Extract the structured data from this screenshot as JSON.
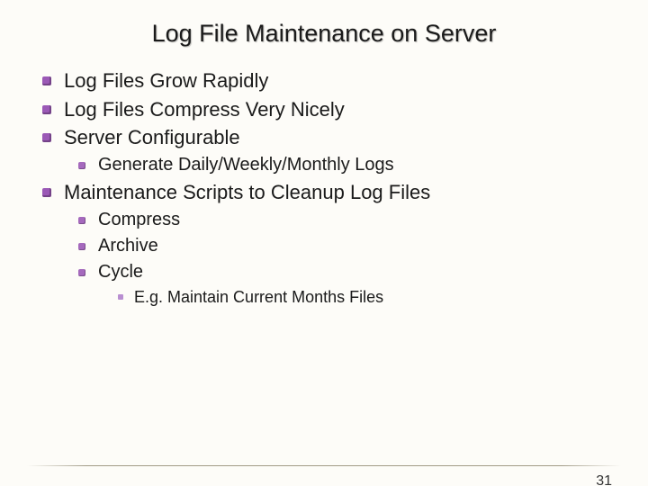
{
  "title": "Log File Maintenance on Server",
  "bullets": {
    "b1": "Log Files Grow Rapidly",
    "b2": "Log Files Compress Very Nicely",
    "b3": "Server Configurable",
    "b3_1": "Generate Daily/Weekly/Monthly Logs",
    "b4": "Maintenance Scripts to Cleanup Log Files",
    "b4_1": "Compress",
    "b4_2": "Archive",
    "b4_3": "Cycle",
    "b4_3_1": "E.g. Maintain Current Months Files"
  },
  "page_number": "31"
}
